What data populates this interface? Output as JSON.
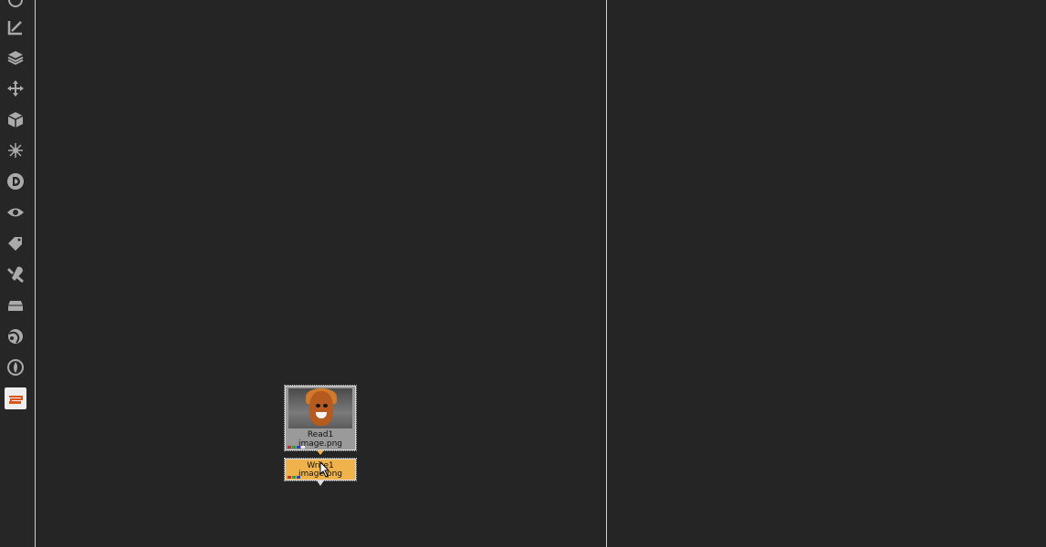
{
  "toolbar": {
    "tools": [
      {
        "icon": "image-icon"
      },
      {
        "icon": "draw-icon"
      },
      {
        "icon": "layers-icon"
      },
      {
        "icon": "transform-icon"
      },
      {
        "icon": "3d-cube-icon"
      },
      {
        "icon": "particles-icon"
      },
      {
        "icon": "deep-icon"
      },
      {
        "icon": "views-icon"
      },
      {
        "icon": "metadata-tag-icon"
      },
      {
        "icon": "toolsets-icon"
      },
      {
        "icon": "other-icon"
      },
      {
        "icon": "furnace-icon"
      },
      {
        "icon": "nukex-icon"
      },
      {
        "icon": "stapler-icon",
        "selected": true
      }
    ]
  },
  "node_graph": {
    "read_node": {
      "label_line1": "Read1",
      "label_line2": "image.png"
    },
    "write_node": {
      "label_line1": "Write1",
      "label_line2": "image.png"
    }
  },
  "colors": {
    "background": "#252525",
    "read_node": "#9a9a9a",
    "write_node": "#f0b34c",
    "divider": "#cfcfcf"
  }
}
